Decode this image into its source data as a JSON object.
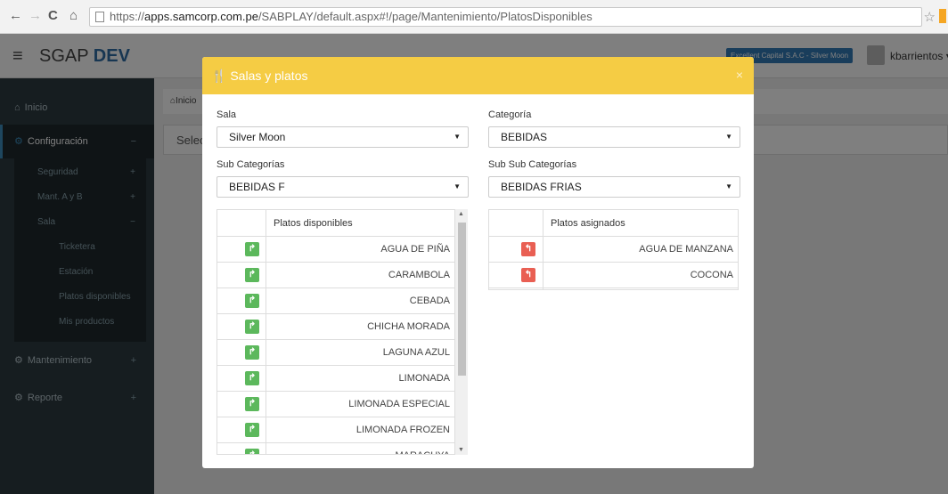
{
  "browser": {
    "url_scheme": "https://",
    "url_host": "apps.samcorp.com.pe",
    "url_path": "/SABPLAY/default.aspx#!/page/Mantenimiento/PlatosDisponibles"
  },
  "header": {
    "brand": "SGAP",
    "brand_suffix": "DEV",
    "company": "Excellent Capital S.A.C - Silver Moon",
    "user": "kbarrientos"
  },
  "sidebar": {
    "items": [
      {
        "label": "Inicio",
        "icon": "home-icon"
      },
      {
        "label": "Configuración",
        "icon": "cogs-icon",
        "toggle": "−"
      },
      {
        "label": "Mantenimiento",
        "icon": "cogs-icon",
        "toggle": "+"
      },
      {
        "label": "Reporte",
        "icon": "cogs-icon",
        "toggle": "+"
      }
    ],
    "sub_items": [
      {
        "label": "Seguridad",
        "toggle": "+"
      },
      {
        "label": "Mant. A y B",
        "toggle": "+"
      },
      {
        "label": "Sala",
        "toggle": "−"
      }
    ],
    "sala_items": [
      "Ticketera",
      "Estación",
      "Platos disponibles",
      "Mis productos"
    ]
  },
  "content": {
    "breadcrumb": "Inicio",
    "select_partial": "Selec"
  },
  "modal": {
    "title": "Salas y platos",
    "close": "×",
    "sala_label": "Sala",
    "sala_value": "Silver Moon",
    "categoria_label": "Categoría",
    "categoria_value": "BEBIDAS",
    "subcat_label": "Sub Categorías",
    "subcat_value": "BEBIDAS F",
    "subsubcat_label": "Sub Sub Categorías",
    "subsubcat_value": "BEBIDAS FRIAS",
    "disponibles_header": "Platos disponibles",
    "asignados_header": "Platos asignados",
    "disponibles": [
      "AGUA DE PIÑA",
      "CARAMBOLA",
      "CEBADA",
      "CHICHA MORADA",
      "LAGUNA AZUL",
      "LIMONADA",
      "LIMONADA ESPECIAL",
      "LIMONADA FROZEN",
      "MARACUYA"
    ],
    "asignados": [
      "AGUA DE MANZANA",
      "COCONA"
    ]
  },
  "colors": {
    "modal_header": "#f5cc44",
    "add_button": "#5cb85c",
    "remove_button": "#e95f53",
    "sidebar": "#2c3b41"
  }
}
